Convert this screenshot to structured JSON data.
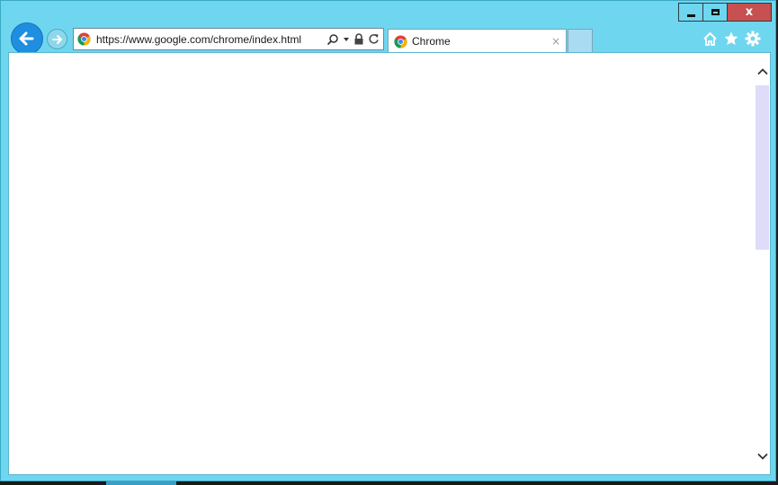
{
  "window": {
    "caption": {
      "minimize_icon": "minimize-icon",
      "maximize_icon": "maximize-icon",
      "close_label": "x"
    }
  },
  "nav": {
    "back_icon": "arrow-left-icon",
    "forward_icon": "arrow-right-icon"
  },
  "address": {
    "url": "https://www.google.com/chrome/index.html",
    "favicon": "chrome-logo-icon",
    "search_icon": "search-icon",
    "dropdown_icon": "chevron-down-icon",
    "lock_icon": "lock-icon",
    "refresh_icon": "refresh-icon"
  },
  "tabs": [
    {
      "title": "Chrome",
      "favicon": "chrome-logo-icon",
      "close_label": "×"
    }
  ],
  "toolbar": {
    "home_icon": "home-icon",
    "favorites_icon": "star-icon",
    "settings_icon": "gear-icon"
  },
  "colors": {
    "frame": "#6fd6ef",
    "close_button": "#c75050",
    "back_button": "#1e8ee0",
    "scroll_thumb": "#dedcf8"
  }
}
